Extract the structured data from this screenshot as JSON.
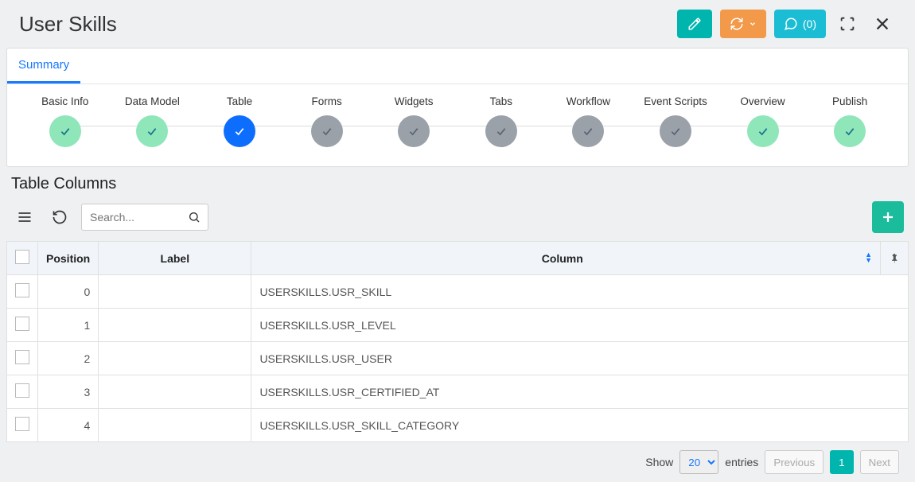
{
  "header": {
    "title": "User Skills",
    "comments_label": "(0)"
  },
  "summary_tab": "Summary",
  "steps": [
    {
      "label": "Basic Info",
      "state": "green"
    },
    {
      "label": "Data Model",
      "state": "green"
    },
    {
      "label": "Table",
      "state": "blue"
    },
    {
      "label": "Forms",
      "state": "gray"
    },
    {
      "label": "Widgets",
      "state": "gray"
    },
    {
      "label": "Tabs",
      "state": "gray"
    },
    {
      "label": "Workflow",
      "state": "gray"
    },
    {
      "label": "Event Scripts",
      "state": "gray"
    },
    {
      "label": "Overview",
      "state": "green"
    },
    {
      "label": "Publish",
      "state": "green"
    }
  ],
  "section": {
    "title": "Table Columns",
    "search_placeholder": "Search..."
  },
  "table": {
    "headers": {
      "position": "Position",
      "label": "Label",
      "column": "Column"
    },
    "rows": [
      {
        "position": "0",
        "label": "",
        "column": "USERSKILLS.USR_SKILL"
      },
      {
        "position": "1",
        "label": "",
        "column": "USERSKILLS.USR_LEVEL"
      },
      {
        "position": "2",
        "label": "",
        "column": "USERSKILLS.USR_USER"
      },
      {
        "position": "3",
        "label": "",
        "column": "USERSKILLS.USR_CERTIFIED_AT"
      },
      {
        "position": "4",
        "label": "",
        "column": "USERSKILLS.USR_SKILL_CATEGORY"
      }
    ]
  },
  "pager": {
    "show": "Show",
    "entries": "entries",
    "size": "20",
    "previous": "Previous",
    "page": "1",
    "next": "Next"
  }
}
